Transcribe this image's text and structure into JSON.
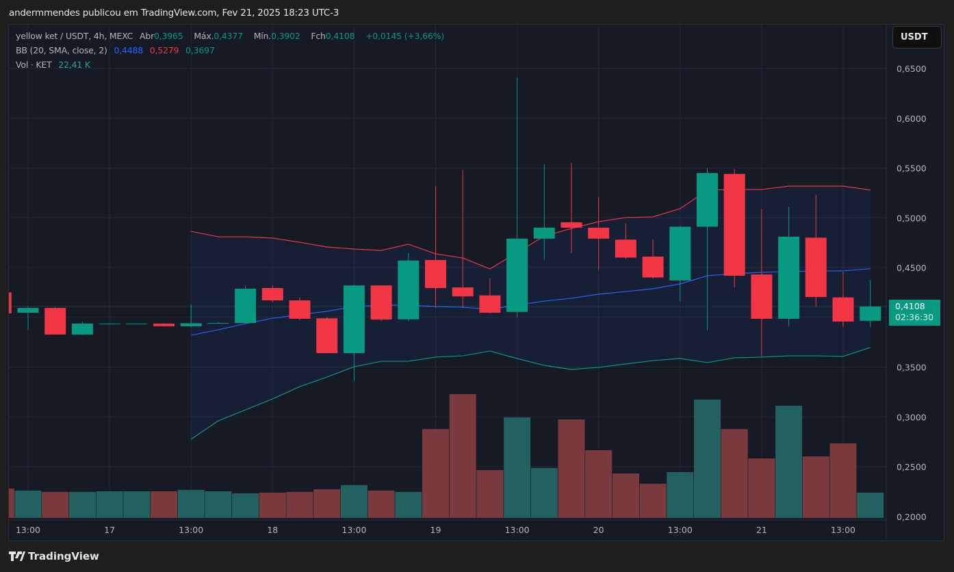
{
  "header": {
    "published": "andermmendes publicou em TradingView.com, Fev 21, 2025 18:23 UTC-3"
  },
  "legend": {
    "symbol": "yellow ket / USDT, 4h, MEXC",
    "open_label": "Abr",
    "open": "0,3965",
    "high_label": "Máx.",
    "high": "0,4377",
    "low_label": "Mín.",
    "low": "0,3902",
    "close_label": "Fch",
    "close": "0,4108",
    "change": "+0,0145 (+3,66%)",
    "bb_label": "BB (20, SMA, close, 2)",
    "bb_basis": "0,4488",
    "bb_upper": "0,5279",
    "bb_lower": "0,3697",
    "vol_label": "Vol · KET",
    "vol": "22,41 K"
  },
  "currency_button": "USDT",
  "current_price": {
    "price": "0,4108",
    "countdown": "02:36:30"
  },
  "footer": {
    "brand": "TradingView"
  },
  "colors": {
    "up": "#089981",
    "down": "#f23645",
    "bb_basis": "#2962ff",
    "bb_upper": "#f23645",
    "bb_lower": "#089981",
    "vol_up": "#22615f",
    "vol_down": "#7a3a3d"
  },
  "chart_data": {
    "type": "candlestick",
    "ylim": [
      0.2,
      0.65
    ],
    "price_ticks": [
      "0,6500",
      "0,6000",
      "0,5500",
      "0,5000",
      "0,4500",
      "0,3500",
      "0,3000",
      "0,2500",
      "0,2000"
    ],
    "price_tick_values": [
      0.65,
      0.6,
      0.55,
      0.5,
      0.45,
      0.35,
      0.3,
      0.25,
      0.2
    ],
    "time_ticks": [
      {
        "label": "13:00",
        "index": 0
      },
      {
        "label": "17",
        "index": 3
      },
      {
        "label": "13:00",
        "index": 6
      },
      {
        "label": "18",
        "index": 9
      },
      {
        "label": "13:00",
        "index": 12
      },
      {
        "label": "19",
        "index": 15
      },
      {
        "label": "13:00",
        "index": 18
      },
      {
        "label": "20",
        "index": 21
      },
      {
        "label": "13:00",
        "index": 24
      },
      {
        "label": "21",
        "index": 27
      },
      {
        "label": "13:00",
        "index": 30
      }
    ],
    "first_index": -1,
    "candles": [
      {
        "o": 0.425,
        "h": 0.428,
        "l": 0.404,
        "c": 0.404,
        "v": 26.0
      },
      {
        "o": 0.4046,
        "h": 0.411,
        "l": 0.3875,
        "c": 0.4094,
        "v": 24.2
      },
      {
        "o": 0.4094,
        "h": 0.41,
        "l": 0.3827,
        "c": 0.3827,
        "v": 23.0
      },
      {
        "o": 0.3827,
        "h": 0.3957,
        "l": 0.382,
        "c": 0.3937,
        "v": 23.0
      },
      {
        "o": 0.3937,
        "h": 0.394,
        "l": 0.3934,
        "c": 0.3937,
        "v": 23.6
      },
      {
        "o": 0.3937,
        "h": 0.394,
        "l": 0.3934,
        "c": 0.3937,
        "v": 23.6
      },
      {
        "o": 0.3937,
        "h": 0.394,
        "l": 0.391,
        "c": 0.391,
        "v": 23.6
      },
      {
        "o": 0.391,
        "h": 0.413,
        "l": 0.39,
        "c": 0.394,
        "v": 24.8
      },
      {
        "o": 0.394,
        "h": 0.395,
        "l": 0.3935,
        "c": 0.3943,
        "v": 23.6
      },
      {
        "o": 0.3943,
        "h": 0.432,
        "l": 0.393,
        "c": 0.4287,
        "v": 21.8
      },
      {
        "o": 0.4294,
        "h": 0.432,
        "l": 0.415,
        "c": 0.417,
        "v": 22.4
      },
      {
        "o": 0.417,
        "h": 0.42,
        "l": 0.397,
        "c": 0.3985,
        "v": 23.0
      },
      {
        "o": 0.399,
        "h": 0.4,
        "l": 0.364,
        "c": 0.364,
        "v": 25.4
      },
      {
        "o": 0.364,
        "h": 0.433,
        "l": 0.336,
        "c": 0.432,
        "v": 29.1
      },
      {
        "o": 0.432,
        "h": 0.432,
        "l": 0.396,
        "c": 0.3978,
        "v": 24.2
      },
      {
        "o": 0.398,
        "h": 0.4645,
        "l": 0.396,
        "c": 0.457,
        "v": 23.0
      },
      {
        "o": 0.4576,
        "h": 0.532,
        "l": 0.4095,
        "c": 0.4294,
        "v": 78.7
      },
      {
        "o": 0.43,
        "h": 0.548,
        "l": 0.4097,
        "c": 0.421,
        "v": 109.6
      },
      {
        "o": 0.422,
        "h": 0.439,
        "l": 0.404,
        "c": 0.4046,
        "v": 42.4
      },
      {
        "o": 0.4054,
        "h": 0.641,
        "l": 0.4,
        "c": 0.479,
        "v": 89.0
      },
      {
        "o": 0.479,
        "h": 0.554,
        "l": 0.458,
        "c": 0.49,
        "v": 44.2
      },
      {
        "o": 0.4954,
        "h": 0.555,
        "l": 0.4645,
        "c": 0.49,
        "v": 87.2
      },
      {
        "o": 0.49,
        "h": 0.521,
        "l": 0.447,
        "c": 0.479,
        "v": 60.0
      },
      {
        "o": 0.478,
        "h": 0.494,
        "l": 0.459,
        "c": 0.46,
        "v": 39.4
      },
      {
        "o": 0.461,
        "h": 0.478,
        "l": 0.439,
        "c": 0.44,
        "v": 30.3
      },
      {
        "o": 0.437,
        "h": 0.492,
        "l": 0.416,
        "c": 0.491,
        "v": 40.6
      },
      {
        "o": 0.491,
        "h": 0.5497,
        "l": 0.387,
        "c": 0.5449,
        "v": 104.8
      },
      {
        "o": 0.544,
        "h": 0.549,
        "l": 0.43,
        "c": 0.4418,
        "v": 78.7
      },
      {
        "o": 0.443,
        "h": 0.509,
        "l": 0.361,
        "c": 0.3985,
        "v": 52.7
      },
      {
        "o": 0.3985,
        "h": 0.511,
        "l": 0.391,
        "c": 0.481,
        "v": 99.3
      },
      {
        "o": 0.48,
        "h": 0.523,
        "l": 0.411,
        "c": 0.4204,
        "v": 54.5
      },
      {
        "o": 0.42,
        "h": 0.4452,
        "l": 0.39,
        "c": 0.3957,
        "v": 66.0
      },
      {
        "o": 0.3965,
        "h": 0.4377,
        "l": 0.3902,
        "c": 0.4108,
        "v": 22.41
      }
    ],
    "bb_start_index": 6,
    "bb_upper": [
      0.4864,
      0.4809,
      0.4809,
      0.4796,
      0.4754,
      0.4706,
      0.4686,
      0.4672,
      0.4734,
      0.4638,
      0.4596,
      0.4486,
      0.4651,
      0.4816,
      0.4892,
      0.4961,
      0.5002,
      0.5009,
      0.5091,
      0.5277,
      0.5284,
      0.5284,
      0.5318,
      0.5318,
      0.5318,
      0.5279
    ],
    "bb_basis": [
      0.382,
      0.3875,
      0.3936,
      0.3991,
      0.4026,
      0.406,
      0.4108,
      0.4122,
      0.4122,
      0.4108,
      0.4101,
      0.4081,
      0.4122,
      0.4163,
      0.4191,
      0.4232,
      0.4259,
      0.4287,
      0.4335,
      0.4418,
      0.4438,
      0.4452,
      0.4459,
      0.4466,
      0.4466,
      0.4488
    ],
    "bb_lower": [
      0.2775,
      0.296,
      0.307,
      0.318,
      0.3304,
      0.34,
      0.3503,
      0.3558,
      0.3558,
      0.36,
      0.3613,
      0.3661,
      0.3586,
      0.3517,
      0.3476,
      0.3497,
      0.3531,
      0.3565,
      0.3586,
      0.3545,
      0.3593,
      0.36,
      0.3613,
      0.3613,
      0.3607,
      0.3697
    ]
  }
}
